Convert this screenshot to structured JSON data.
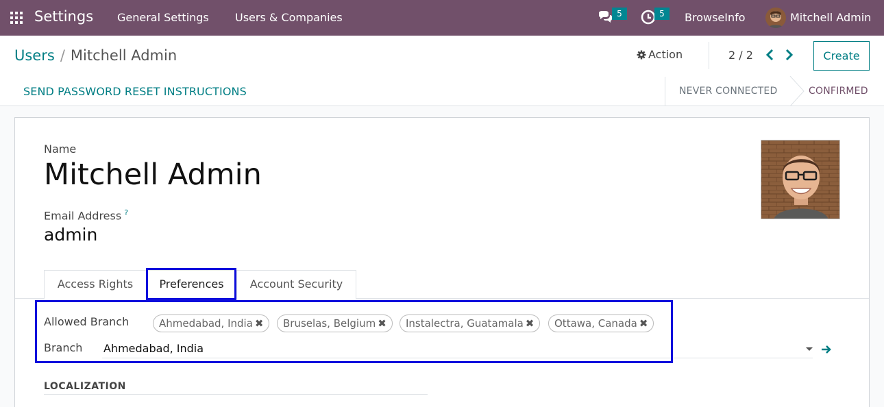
{
  "navbar": {
    "app_name": "Settings",
    "menu": [
      "General Settings",
      "Users & Companies"
    ],
    "messages_badge": "5",
    "activities_badge": "5",
    "company": "BrowseInfo",
    "user_name": "Mitchell Admin",
    "bg_color": "#71506a"
  },
  "control_panel": {
    "breadcrumb_root": "Users",
    "breadcrumb_sep": "/",
    "breadcrumb_current": "Mitchell Admin",
    "action_label": "Action",
    "pager": "2 / 2",
    "create_label": "Create",
    "statusbar_button": "SEND PASSWORD RESET INSTRUCTIONS",
    "stages": [
      "NEVER CONNECTED",
      "CONFIRMED"
    ]
  },
  "form": {
    "name_label": "Name",
    "name_value": "Mitchell Admin",
    "email_label": "Email Address",
    "email_help": "?",
    "email_value": "admin",
    "tabs": [
      "Access Rights",
      "Preferences",
      "Account Security"
    ],
    "active_tab": "Preferences",
    "allowed_branch_label": "Allowed Branch",
    "allowed_branches": [
      "Ahmedabad, India",
      "Bruselas, Belgium",
      "Instalectra, Guatamala",
      "Ottawa, Canada"
    ],
    "branch_label": "Branch",
    "branch_value": "Ahmedabad, India",
    "localization_title": "LOCALIZATION"
  },
  "colors": {
    "accent": "#017e84",
    "highlight": "#0d0ddc",
    "stage_active": "#71506a"
  },
  "icons": [
    "apps-grid-icon",
    "chat-icon",
    "clock-icon",
    "gear-icon",
    "chevron-left-icon",
    "chevron-right-icon",
    "remove-tag-icon",
    "dropdown-caret-icon",
    "external-link-arrow-icon"
  ]
}
